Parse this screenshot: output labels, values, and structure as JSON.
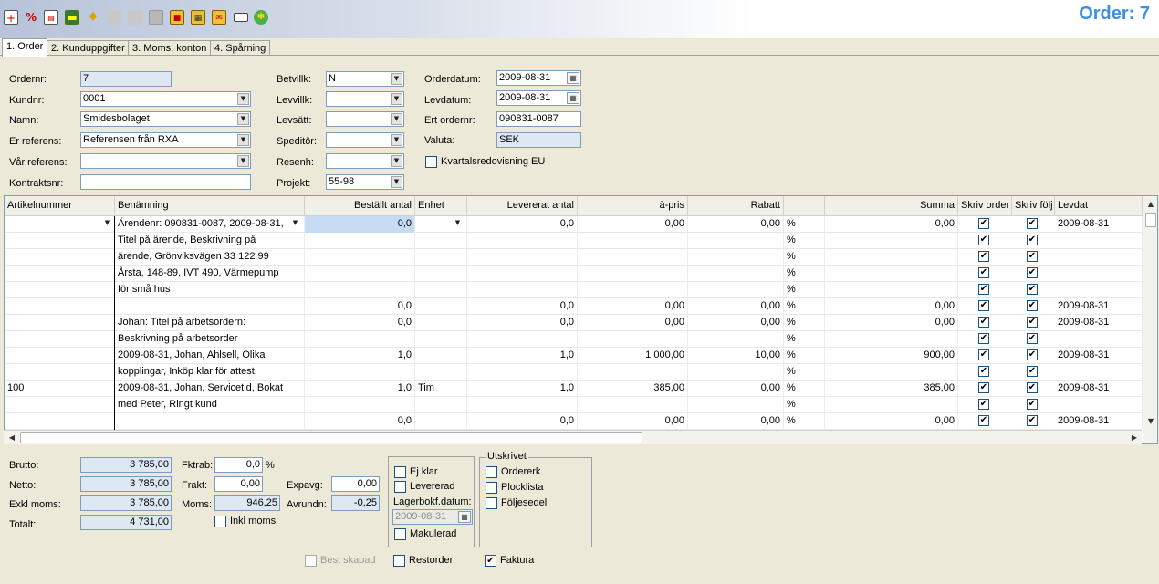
{
  "header": {
    "order_title": "Order: 7"
  },
  "toolbar": {
    "icons": [
      "new-document-icon",
      "percent-icon",
      "pdf-document-icon",
      "cart-icon",
      "bell-icon",
      "save-disabled-icon",
      "disk-disabled-icon",
      "fax-icon",
      "print-icon",
      "print-preview-icon",
      "mail-icon",
      "envelope-icon",
      "globe-icon"
    ]
  },
  "tabs": [
    {
      "label": "1. Order"
    },
    {
      "label": "2. Kunduppgifter"
    },
    {
      "label": "3. Moms, konton"
    },
    {
      "label": "4. Spårning"
    }
  ],
  "form": {
    "ordernr": {
      "label": "Ordernr:",
      "value": "7"
    },
    "kundnr": {
      "label": "Kundnr:",
      "value": "0001"
    },
    "namn": {
      "label": "Namn:",
      "value": "Smidesbolaget"
    },
    "er_referens": {
      "label": "Er referens:",
      "value": "Referensen från RXA"
    },
    "var_referens": {
      "label": "Vår referens:",
      "value": ""
    },
    "kontraktsnr": {
      "label": "Kontraktsnr:",
      "value": ""
    },
    "betvillk": {
      "label": "Betvillk:",
      "value": "N"
    },
    "levvillk": {
      "label": "Levvillk:",
      "value": ""
    },
    "levsatt": {
      "label": "Levsätt:",
      "value": ""
    },
    "speditor": {
      "label": "Speditör:",
      "value": ""
    },
    "resenh": {
      "label": "Resenh:",
      "value": ""
    },
    "projekt": {
      "label": "Projekt:",
      "value": "55-98"
    },
    "orderdatum": {
      "label": "Orderdatum:",
      "value": "2009-08-31"
    },
    "levdatum": {
      "label": "Levdatum:",
      "value": "2009-08-31"
    },
    "ert_ordernr": {
      "label": "Ert ordernr:",
      "value": "090831-0087"
    },
    "valuta": {
      "label": "Valuta:",
      "value": "SEK"
    },
    "kvartal": {
      "label": "Kvartalsredovisning EU",
      "checked": false
    }
  },
  "grid": {
    "columns": [
      "Artikelnummer",
      "Benämning",
      "Beställt antal",
      "Enhet",
      "Levererat antal",
      "à-pris",
      "Rabatt",
      "",
      "Summa",
      "Skriv order",
      "Skriv följ",
      "Levdat"
    ],
    "rows": [
      {
        "art": "",
        "ben": "Ärendenr: 090831-0087, 2009-08-31,",
        "best": "0,0",
        "enhet": "",
        "lev": "0,0",
        "pris": "0,00",
        "rabatt": "0,00",
        "pct": "%",
        "summa": "0,00",
        "skriv_order": true,
        "skriv_folj": true,
        "levdat": "2009-08-31"
      },
      {
        "art": "",
        "ben": "Titel på ärende, Beskrivning på",
        "best": "",
        "enhet": "",
        "lev": "",
        "pris": "",
        "rabatt": "",
        "pct": "%",
        "summa": "",
        "skriv_order": true,
        "skriv_folj": true,
        "levdat": ""
      },
      {
        "art": "",
        "ben": "ärende, Grönviksvägen 33 122 99",
        "best": "",
        "enhet": "",
        "lev": "",
        "pris": "",
        "rabatt": "",
        "pct": "%",
        "summa": "",
        "skriv_order": true,
        "skriv_folj": true,
        "levdat": ""
      },
      {
        "art": "",
        "ben": "Årsta, 148-89, IVT 490, Värmepump",
        "best": "",
        "enhet": "",
        "lev": "",
        "pris": "",
        "rabatt": "",
        "pct": "%",
        "summa": "",
        "skriv_order": true,
        "skriv_folj": true,
        "levdat": ""
      },
      {
        "art": "",
        "ben": "för små hus",
        "best": "",
        "enhet": "",
        "lev": "",
        "pris": "",
        "rabatt": "",
        "pct": "%",
        "summa": "",
        "skriv_order": true,
        "skriv_folj": true,
        "levdat": ""
      },
      {
        "art": "",
        "ben": "",
        "best": "0,0",
        "enhet": "",
        "lev": "0,0",
        "pris": "0,00",
        "rabatt": "0,00",
        "pct": "%",
        "summa": "0,00",
        "skriv_order": true,
        "skriv_folj": true,
        "levdat": "2009-08-31"
      },
      {
        "art": "",
        "ben": "Johan: Titel på arbetsordern:",
        "best": "0,0",
        "enhet": "",
        "lev": "0,0",
        "pris": "0,00",
        "rabatt": "0,00",
        "pct": "%",
        "summa": "0,00",
        "skriv_order": true,
        "skriv_folj": true,
        "levdat": "2009-08-31"
      },
      {
        "art": "",
        "ben": "Beskrivning på arbetsorder",
        "best": "",
        "enhet": "",
        "lev": "",
        "pris": "",
        "rabatt": "",
        "pct": "%",
        "summa": "",
        "skriv_order": true,
        "skriv_folj": true,
        "levdat": ""
      },
      {
        "art": "",
        "ben": "2009-08-31, Johan, Ahlsell, Olika",
        "best": "1,0",
        "enhet": "",
        "lev": "1,0",
        "pris": "1 000,00",
        "rabatt": "10,00",
        "pct": "%",
        "summa": "900,00",
        "skriv_order": true,
        "skriv_folj": true,
        "levdat": "2009-08-31"
      },
      {
        "art": "",
        "ben": "kopplingar, Inköp klar för attest,",
        "best": "",
        "enhet": "",
        "lev": "",
        "pris": "",
        "rabatt": "",
        "pct": "%",
        "summa": "",
        "skriv_order": true,
        "skriv_folj": true,
        "levdat": ""
      },
      {
        "art": "100",
        "ben": "2009-08-31, Johan, Servicetid, Bokat",
        "best": "1,0",
        "enhet": "Tim",
        "lev": "1,0",
        "pris": "385,00",
        "rabatt": "0,00",
        "pct": "%",
        "summa": "385,00",
        "skriv_order": true,
        "skriv_folj": true,
        "levdat": "2009-08-31"
      },
      {
        "art": "",
        "ben": "med Peter, Ringt kund",
        "best": "",
        "enhet": "",
        "lev": "",
        "pris": "",
        "rabatt": "",
        "pct": "%",
        "summa": "",
        "skriv_order": true,
        "skriv_folj": true,
        "levdat": ""
      },
      {
        "art": "",
        "ben": "",
        "best": "0,0",
        "enhet": "",
        "lev": "0,0",
        "pris": "0,00",
        "rabatt": "0,00",
        "pct": "%",
        "summa": "0,00",
        "skriv_order": true,
        "skriv_folj": true,
        "levdat": "2009-08-31"
      }
    ]
  },
  "totals": {
    "brutto": {
      "label": "Brutto:",
      "value": "3 785,00"
    },
    "netto": {
      "label": "Netto:",
      "value": "3 785,00"
    },
    "exkl_moms": {
      "label": "Exkl moms:",
      "value": "3 785,00"
    },
    "totalt": {
      "label": "Totalt:",
      "value": "4 731,00"
    },
    "fktrab": {
      "label": "Fktrab:",
      "value": "0,0",
      "unit": "%"
    },
    "frakt": {
      "label": "Frakt:",
      "value": "0,00"
    },
    "moms": {
      "label": "Moms:",
      "value": "946,25"
    },
    "inkl_moms": {
      "label": "Inkl moms",
      "checked": false
    },
    "expavg": {
      "label": "Expavg:",
      "value": "0,00"
    },
    "avrundn": {
      "label": "Avrundn:",
      "value": "-0,25"
    }
  },
  "status": {
    "ej_klar": {
      "label": "Ej klar",
      "checked": false
    },
    "levererad": {
      "label": "Levererad",
      "checked": false
    },
    "lagerbokf_label": "Lagerbokf.datum:",
    "lagerbokf_value": "2009-08-31",
    "makulerad": {
      "label": "Makulerad",
      "checked": false
    }
  },
  "utskrivet": {
    "title": "Utskrivet",
    "ordererk": {
      "label": "Ordererk",
      "checked": false
    },
    "plocklista": {
      "label": "Plocklista",
      "checked": false
    },
    "foljesedel": {
      "label": "Följesedel",
      "checked": false
    }
  },
  "bottom": {
    "best_skapad": {
      "label": "Best skapad",
      "checked": false,
      "disabled": true
    },
    "restorder": {
      "label": "Restorder",
      "checked": false
    },
    "faktura": {
      "label": "Faktura",
      "checked": true
    }
  },
  "check_glyph": "✔"
}
